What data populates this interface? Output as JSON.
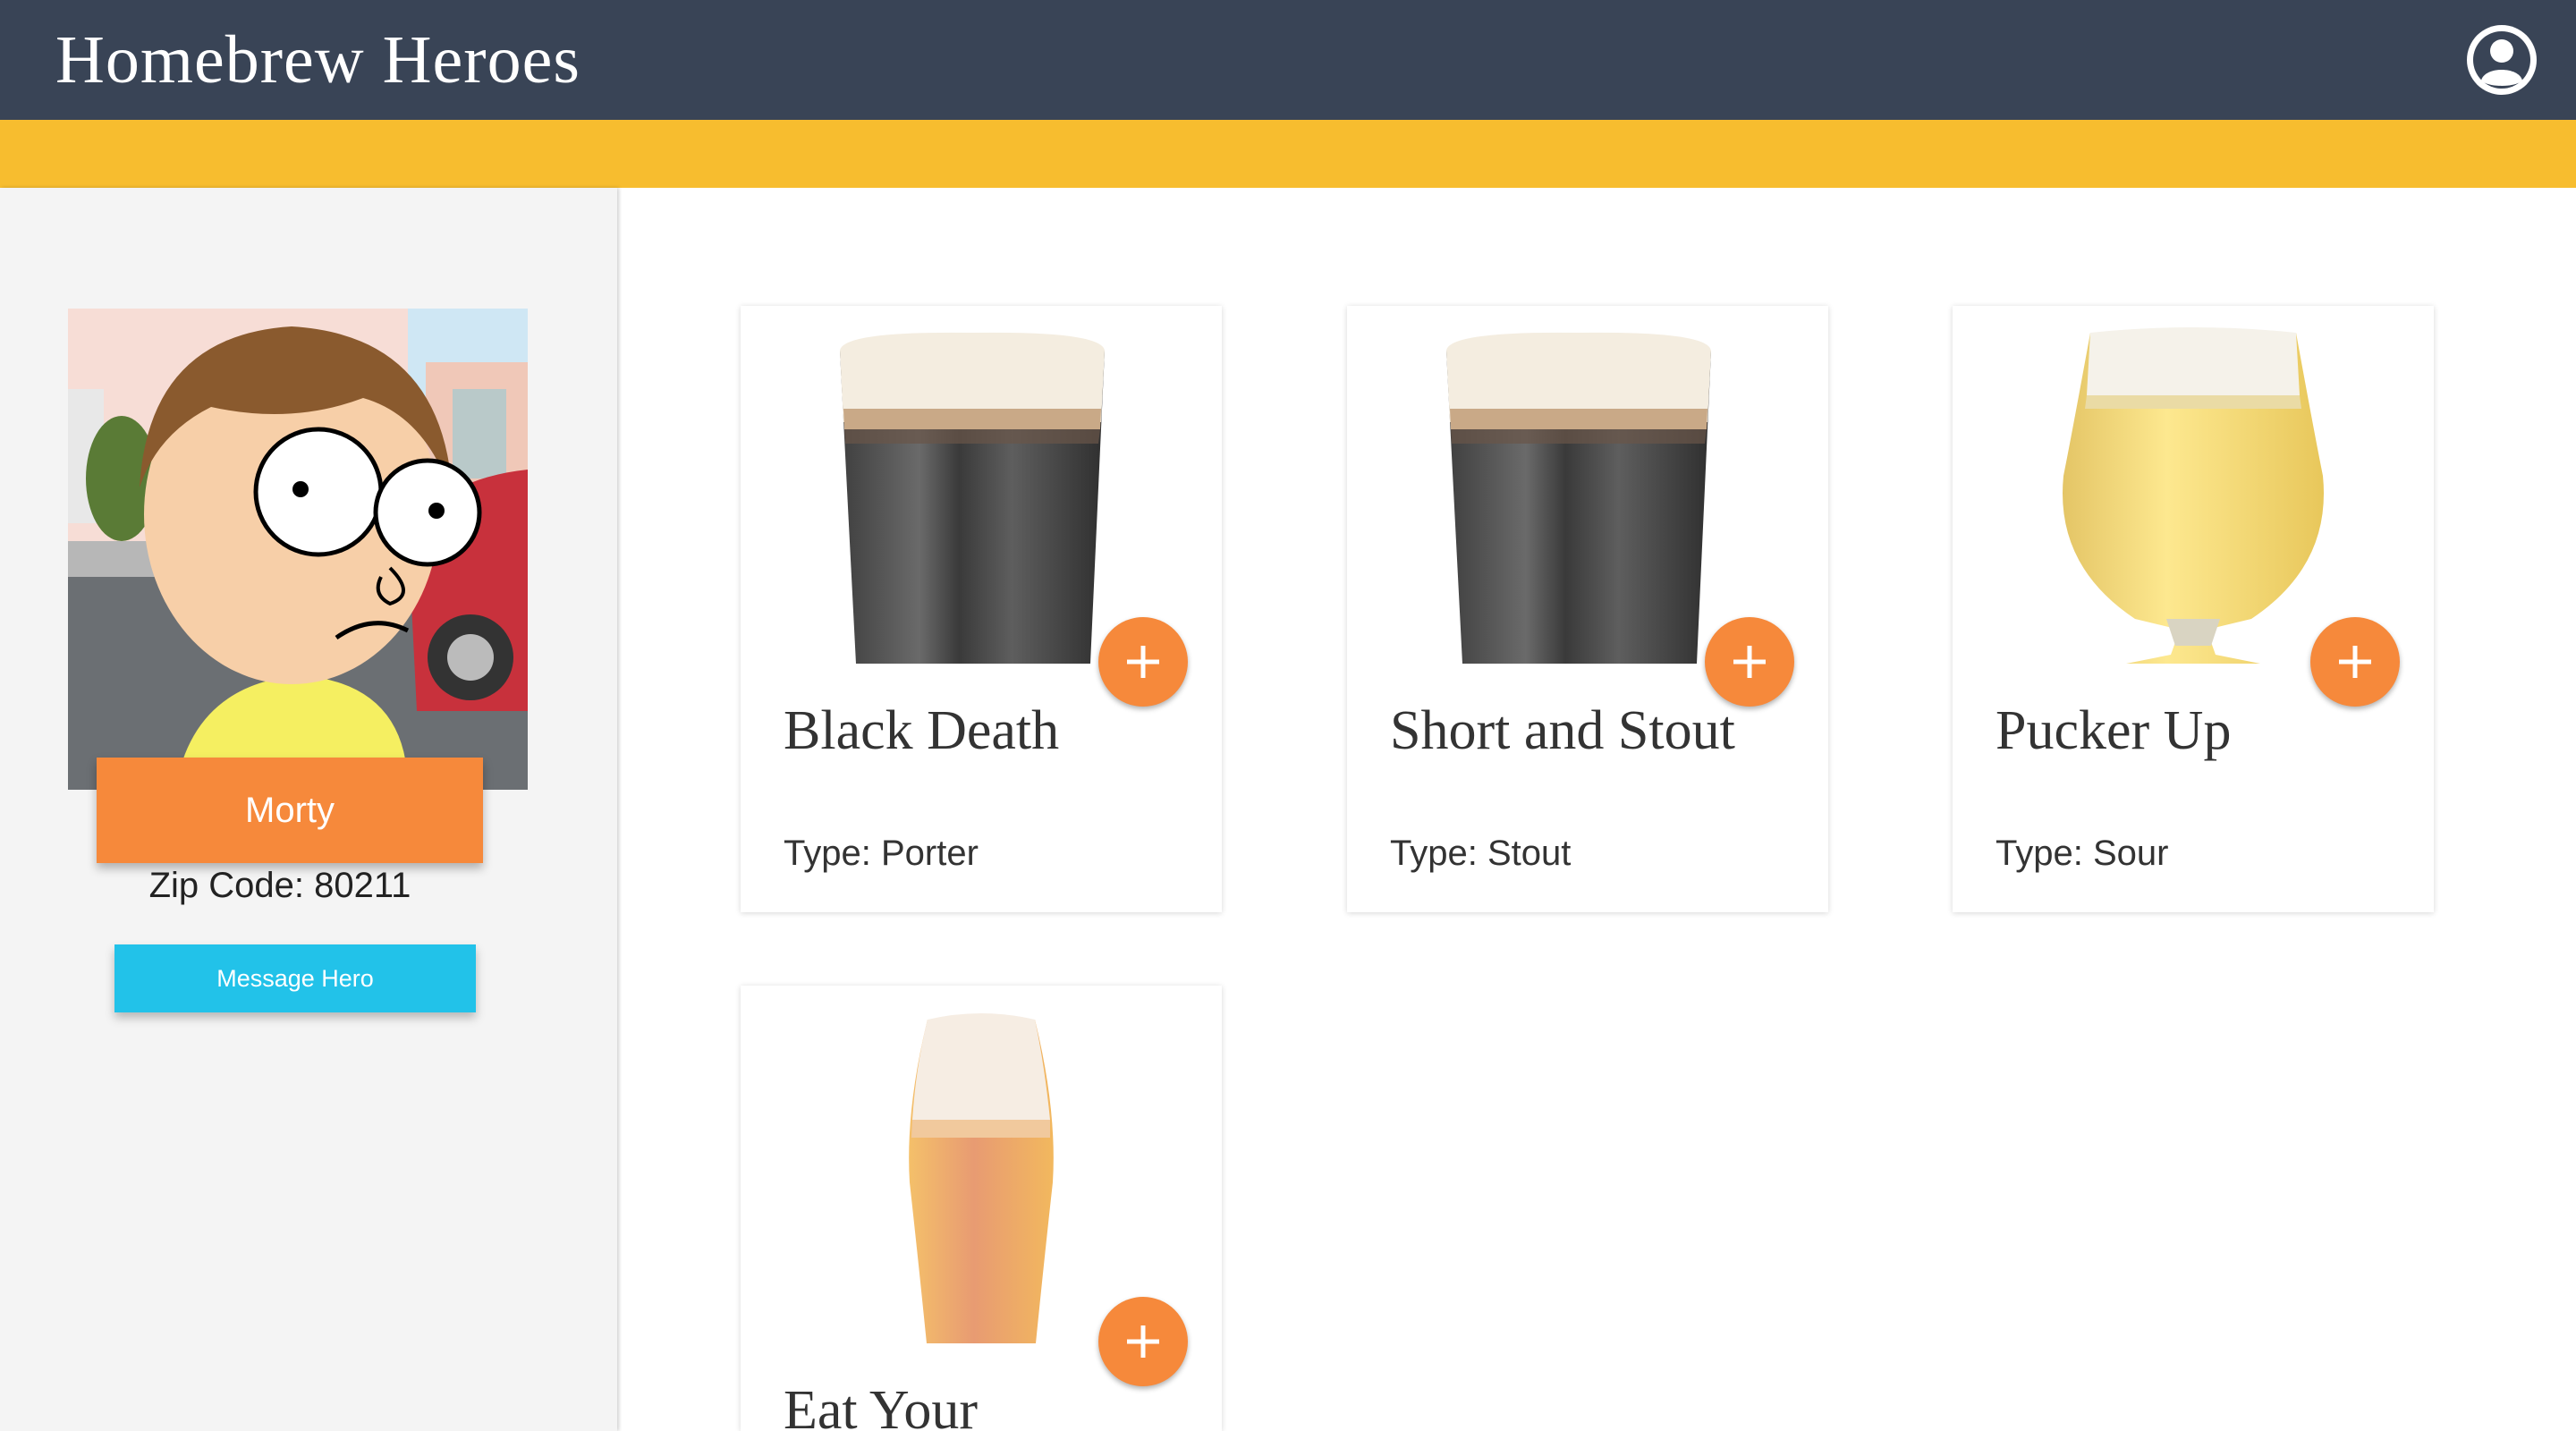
{
  "header": {
    "title": "Homebrew Heroes",
    "account_icon": "account-circle-icon"
  },
  "colors": {
    "header_bg": "#394456",
    "accent_bar": "#f7bd2f",
    "primary": "#f6893b",
    "message_button": "#22c2e9"
  },
  "profile": {
    "name": "Morty",
    "zip_label": "Zip Code:",
    "zip_code": "80211",
    "message_button_label": "Message Hero"
  },
  "beers": [
    {
      "name": "Black Death",
      "type_label": "Type:",
      "type": "Porter",
      "glass": "pint-glass-dark"
    },
    {
      "name": "Short and Stout",
      "type_label": "Type:",
      "type": "Stout",
      "glass": "pint-glass-dark"
    },
    {
      "name": "Pucker Up",
      "type_label": "Type:",
      "type": "Sour",
      "glass": "tulip-glass-pale"
    },
    {
      "name": "Eat Your",
      "type_label": "",
      "type": "",
      "glass": "weizen-glass-amber"
    }
  ],
  "add_button_icon": "plus-icon"
}
